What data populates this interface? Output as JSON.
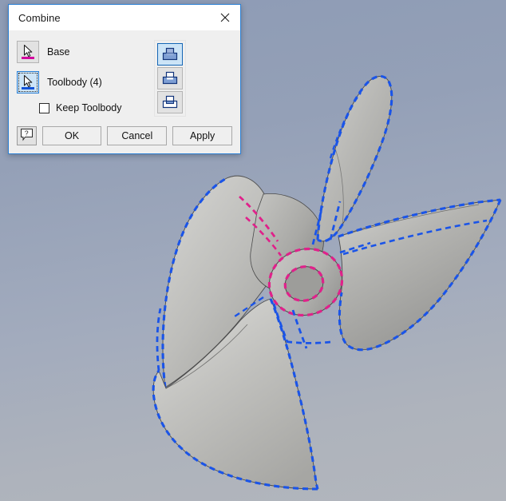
{
  "viewport": {
    "name": "3d-model-viewport",
    "model": "marine-propeller",
    "background_top_color": "#8d9bb5",
    "background_bottom_color": "#b2b6bd",
    "surface_color": "#b9b9b6",
    "base_highlight_color": "#e0218a",
    "toolbody_highlight_color": "#1a54e8",
    "edge_color": "#3a3a3a"
  },
  "dialog": {
    "title": "Combine",
    "close_icon": "close-icon",
    "selectors": [
      {
        "id": "base",
        "label": "Base",
        "icon": "select-cursor-icon",
        "accent": "#d2089e",
        "selected": false
      },
      {
        "id": "toolbody",
        "label": "Toolbody (4)",
        "icon": "select-cursor-icon",
        "accent": "#1052d8",
        "selected": true
      }
    ],
    "keep_toolbody": {
      "label": "Keep Toolbody",
      "checked": false
    },
    "operations": [
      {
        "id": "join",
        "label": "Join",
        "icon": "boolean-join-icon",
        "active": true
      },
      {
        "id": "cut",
        "label": "Cut",
        "icon": "boolean-cut-icon",
        "active": false
      },
      {
        "id": "intersect",
        "label": "Intersect",
        "icon": "boolean-intersect-icon",
        "active": false
      }
    ],
    "buttons": {
      "help_label": "?",
      "help_icon": "help-question-icon",
      "ok_label": "OK",
      "cancel_label": "Cancel",
      "apply_label": "Apply"
    }
  }
}
